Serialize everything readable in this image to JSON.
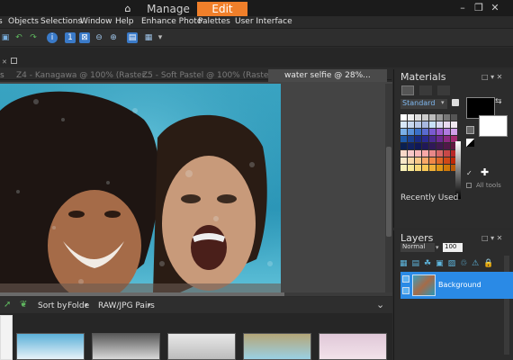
{
  "topbar": {
    "home_icon": "home-icon",
    "tabs": [
      {
        "label": "Manage"
      },
      {
        "label": "Edit"
      }
    ],
    "active_color": "#f07f2a"
  },
  "menu": {
    "items": [
      "Objects",
      "Selections",
      "Window",
      "Help",
      "Enhance Photo",
      "Palettes",
      "User Interface"
    ]
  },
  "documents": {
    "tabs": [
      {
        "label": "Z4 - Kanagawa @ 100% (Raster..."
      },
      {
        "label": "Z5 - Soft Pastel @ 100% (Raster..."
      },
      {
        "label": "water selfie @  28%..."
      }
    ]
  },
  "organizer": {
    "sort_label": "Sort by",
    "sort_value": "Folde",
    "filter_value": "RAW/JPG Pairs"
  },
  "materials": {
    "title": "Materials",
    "mode": "Standard",
    "recently_used": "Recently Used",
    "all_tools": "All tools"
  },
  "layers": {
    "title": "Layers",
    "blend_mode": "Normal",
    "opacity": "100",
    "layer_name": "Background"
  }
}
